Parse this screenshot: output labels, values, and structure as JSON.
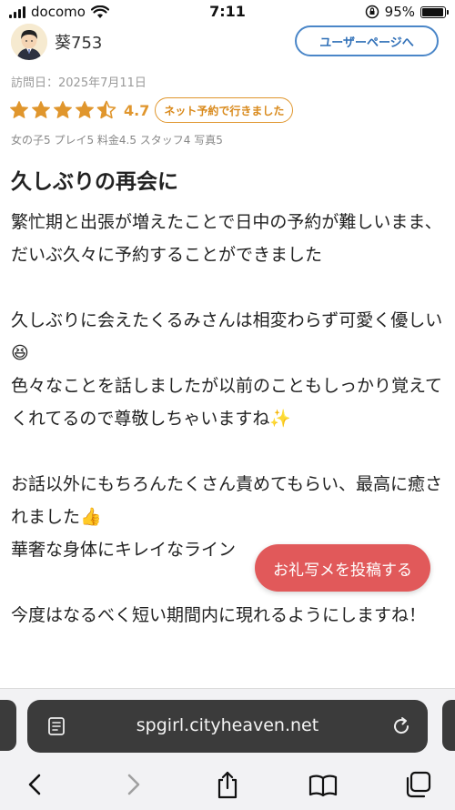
{
  "status_bar": {
    "carrier": "docomo",
    "time": "7:11",
    "battery": "95%",
    "battery_level": 0.95
  },
  "user": {
    "name": "葵753",
    "page_button": "ユーザーページへ"
  },
  "review": {
    "visit_date": "訪問日：2025年7月11日",
    "rating_value": "4.7",
    "stars_full": 4,
    "stars_half": 1,
    "reserve_badge": "ネット予約で行きました",
    "sub_ratings": "女の子5 プレイ5 料金4.5 スタッフ4 写真5",
    "title": "久しぶりの再会に",
    "body": "繁忙期と出張が増えたことで日中の予約が難しいまま、だいぶ久々に予約することができました\n\n久しぶりに会えたくるみさんは相変わらず可愛く優しい😆\n色々なことを話しましたが以前のこともしっかり覚えてくれてるので尊敬しちゃいますね✨\n\nお話以外にもちろんたくさん責めてもらい、最高に癒されました👍\n華奢な身体にキレイなライン\n\n今度はなるべく短い期間内に現れるようにしますね！"
  },
  "floating_button": {
    "label": "お礼写メを投稿する"
  },
  "safari": {
    "url": "spgirl.cityheaven.net",
    "icons": [
      "reader-icon",
      "reload-icon",
      "back-icon",
      "forward-icon",
      "share-icon",
      "bookmarks-icon",
      "tabs-icon"
    ]
  },
  "colors": {
    "accent_blue": "#4a86c8",
    "star_orange": "#e0962d",
    "photo_button": "#e1595a",
    "address_bar": "#3b3b3b"
  }
}
